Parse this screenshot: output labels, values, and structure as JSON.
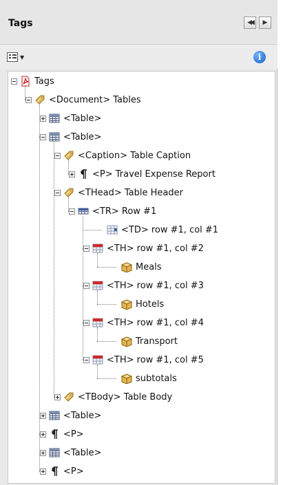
{
  "panel": {
    "title": "Tags",
    "buttons": {
      "collapse": "◀◀",
      "next": "▶"
    }
  },
  "toolbar": {
    "options_icon": "options-menu-icon",
    "info_icon": "info-icon",
    "info_glyph": "i"
  },
  "tree": [
    {
      "label": "Tags",
      "icon": "pdf-tags-icon",
      "toggle": "minus"
    },
    {
      "label": "<Document> Tables",
      "icon": "tag-icon",
      "toggle": "minus"
    },
    {
      "label": "<Table>",
      "icon": "table-icon",
      "toggle": "plus"
    },
    {
      "label": "<Table>",
      "icon": "table-icon",
      "toggle": "minus"
    },
    {
      "label": "<Caption> Table Caption",
      "icon": "tag-icon",
      "toggle": "minus"
    },
    {
      "label": "<P> Travel Expense Report",
      "icon": "paragraph-icon",
      "toggle": "plus"
    },
    {
      "label": "<THead> Table Header",
      "icon": "tag-icon",
      "toggle": "minus"
    },
    {
      "label": "<TR> Row #1",
      "icon": "table-row-icon",
      "toggle": "minus"
    },
    {
      "label": "<TD> row #1, col #1",
      "icon": "table-cell-icon",
      "toggle": "none"
    },
    {
      "label": "<TH> row #1, col #2",
      "icon": "table-header-cell-icon",
      "toggle": "minus"
    },
    {
      "label": "Meals",
      "icon": "content-box-icon",
      "toggle": "none"
    },
    {
      "label": "<TH> row #1, col #3",
      "icon": "table-header-cell-icon",
      "toggle": "minus"
    },
    {
      "label": "Hotels",
      "icon": "content-box-icon",
      "toggle": "none"
    },
    {
      "label": "<TH> row #1, col #4",
      "icon": "table-header-cell-icon",
      "toggle": "minus"
    },
    {
      "label": "Transport",
      "icon": "content-box-icon",
      "toggle": "none"
    },
    {
      "label": "<TH> row #1, col #5",
      "icon": "table-header-cell-icon",
      "toggle": "minus"
    },
    {
      "label": "subtotals",
      "icon": "content-box-icon",
      "toggle": "none"
    },
    {
      "label": "<TBody> Table Body",
      "icon": "tag-icon",
      "toggle": "plus"
    },
    {
      "label": "<Table>",
      "icon": "table-icon",
      "toggle": "plus"
    },
    {
      "label": "<P>",
      "icon": "paragraph-icon",
      "toggle": "plus"
    },
    {
      "label": "<Table>",
      "icon": "table-icon",
      "toggle": "plus"
    },
    {
      "label": "<P>",
      "icon": "paragraph-icon",
      "toggle": "plus"
    }
  ]
}
